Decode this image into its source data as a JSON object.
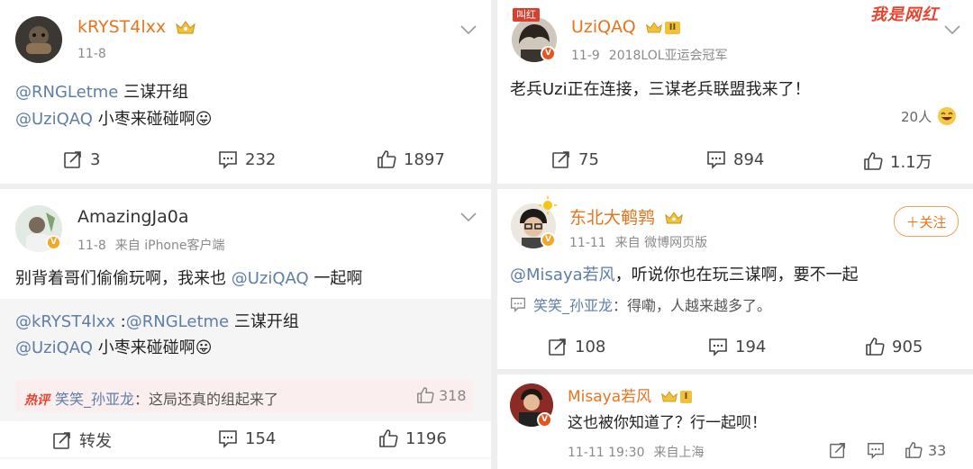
{
  "colors": {
    "accent": "#eb7350",
    "link": "#5e7ea8",
    "meta": "#8a8a8a",
    "hot": "#e8432e"
  },
  "post1": {
    "username": "kRYST4lxx",
    "date": "11-8",
    "mention1": "@RNGLetme",
    "text1": " 三谋开组",
    "mention2": "@UziQAQ",
    "text2": " 小枣来碰碰啊😛",
    "repost_count": "3",
    "comment_count": "232",
    "like_count": "1897"
  },
  "post2": {
    "username": "UziQAQ",
    "avatar_tag": "叫红",
    "level": "II",
    "date": "11-9",
    "verified_title": "2018LOL亚运会冠军",
    "text": "老兵Uzi正在连接，三谋老兵联盟我来了！",
    "reaction_count": "20人",
    "repost_count": "75",
    "comment_count": "894",
    "like_count": "1.1万",
    "watermark": "我是网红"
  },
  "post3": {
    "username": "AmazingJa0a",
    "date": "11-8",
    "source": "来自 iPhone客户端",
    "text_before": "别背着哥们偷偷玩啊，我来也 ",
    "mention": "@UziQAQ",
    "text_after": " 一起啊",
    "quote_user": "@kRYST4lxx",
    "quote_sep": " :",
    "quote_mention1": "@RNGLetme",
    "quote_text1": " 三谋开组",
    "quote_mention2": "@UziQAQ",
    "quote_text2": " 小枣来碰碰啊😛",
    "hot_label": "热评",
    "hot_user": "笑笑_孙亚龙",
    "hot_text": "：这局还真的组起来了",
    "hot_likes": "318",
    "repost_label": "转发",
    "comment_count": "154",
    "like_count": "1196"
  },
  "post4": {
    "username": "东北大鹌鹑",
    "date": "11-11",
    "source": "来自 微博网页版",
    "follow_label": "＋关注",
    "mention": "@Misaya若风",
    "text": "，听说你也在玩三谋啊，要不一起",
    "reply_user": "笑笑_孙亚龙",
    "reply_text": "：得嘞，人越来越多了。",
    "repost_count": "108",
    "comment_count": "194",
    "like_count": "905"
  },
  "comment": {
    "username": "Misaya若风",
    "level": "I",
    "text": "这也被你知道了？行一起呗！",
    "time": "11-11 19:30",
    "location": "来自上海",
    "like_count": "33"
  }
}
